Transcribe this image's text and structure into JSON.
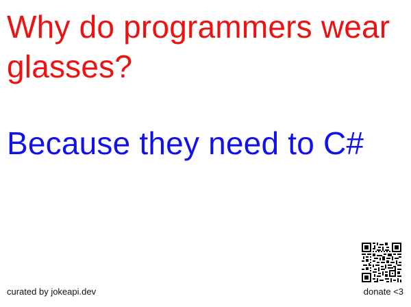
{
  "joke": {
    "setup": "Why do programmers wear glasses?",
    "punchline": "Because they need to C#"
  },
  "footer": {
    "credit": "curated by jokeapi.dev",
    "donate": "donate <3"
  },
  "colors": {
    "setup": "#ee1111",
    "punchline": "#1111ee",
    "footer_text": "#111111",
    "background": "#ffffff"
  },
  "icons": {
    "donate_qr": "qr-code-icon"
  }
}
